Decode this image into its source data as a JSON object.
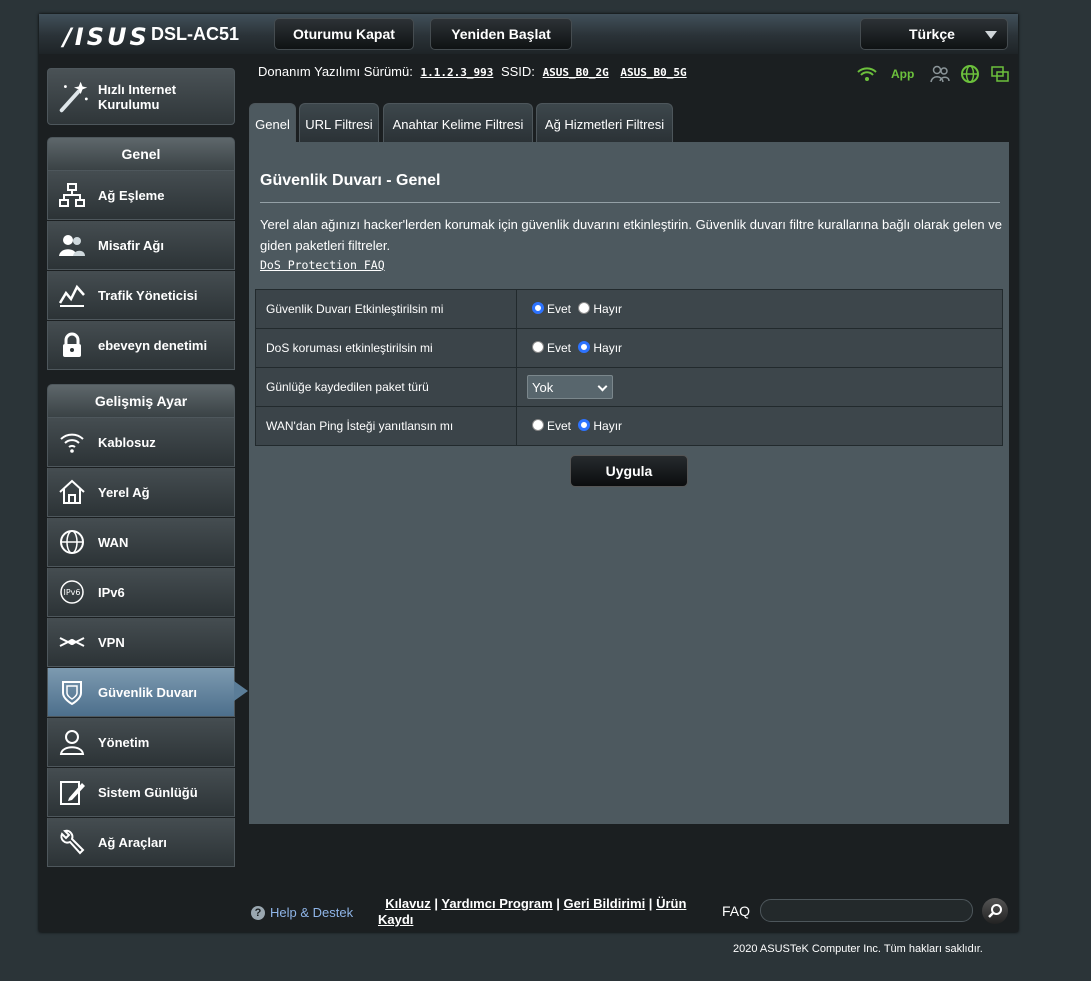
{
  "header": {
    "logo": "/ISUS",
    "model": "DSL-AC51",
    "logout_label": "Oturumu Kapat",
    "reboot_label": "Yeniden Başlat",
    "language": "Türkçe"
  },
  "sidebar": {
    "qis_label": "Hızlı Internet Kurulumu",
    "general_title": "Genel",
    "general_items": [
      {
        "label": "Ağ Eşleme",
        "icon": "network-map-icon"
      },
      {
        "label": "Misafir Ağı",
        "icon": "guest-network-icon"
      },
      {
        "label": "Trafik Yöneticisi",
        "icon": "traffic-manager-icon"
      },
      {
        "label": "ebeveyn denetimi",
        "icon": "lock-icon"
      }
    ],
    "advanced_title": "Gelişmiş Ayar",
    "advanced_items": [
      {
        "label": "Kablosuz",
        "icon": "wifi-icon"
      },
      {
        "label": "Yerel Ağ",
        "icon": "home-icon"
      },
      {
        "label": "WAN",
        "icon": "globe-icon"
      },
      {
        "label": "IPv6",
        "icon": "ipv6-icon"
      },
      {
        "label": "VPN",
        "icon": "vpn-icon"
      },
      {
        "label": "Güvenlik Duvarı",
        "icon": "shield-icon",
        "active": true
      },
      {
        "label": "Yönetim",
        "icon": "admin-user-icon"
      },
      {
        "label": "Sistem Günlüğü",
        "icon": "system-log-icon"
      },
      {
        "label": "Ağ Araçları",
        "icon": "tools-icon"
      }
    ]
  },
  "status": {
    "firmware_label": "Donanım Yazılımı Sürümü:",
    "firmware_version": "1.1.2.3_993",
    "ssid_label": "SSID:",
    "ssid_2g": "ASUS_B0_2G",
    "ssid_5g": "ASUS_B0_5G",
    "app_label": "App",
    "accent_green": "#6cc13c"
  },
  "tabs": [
    "Genel",
    "URL Filtresi",
    "Anahtar Kelime Filtresi",
    "Ağ Hizmetleri Filtresi"
  ],
  "content": {
    "title": "Güvenlik Duvarı - Genel",
    "description": "Yerel alan ağınızı hacker'lerden korumak için güvenlik duvarını etkinleştirin. Güvenlik duvarı filtre kurallarına bağlı olarak gelen ve giden paketleri filtreler.",
    "faq_link": "DoS Protection FAQ",
    "rows": {
      "firewall": {
        "label": "Güvenlik Duvarı Etkinleştirilsin mi",
        "yes": "Evet",
        "no": "Hayır",
        "selected": "yes"
      },
      "dos": {
        "label": "DoS koruması etkinleştirilsin mi",
        "yes": "Evet",
        "no": "Hayır",
        "selected": "no"
      },
      "log": {
        "label": "Günlüğe kaydedilen paket türü",
        "value": "Yok"
      },
      "ping": {
        "label": "WAN'dan Ping İsteği yanıtlansın mı",
        "yes": "Evet",
        "no": "Hayır",
        "selected": "no"
      }
    },
    "apply_label": "Uygula"
  },
  "footer": {
    "help_label": "Help & Destek",
    "link_manual": "Kılavuz",
    "link_utility": "Yardımcı Program",
    "link_feedback": "Geri Bildirimi",
    "link_register": "Ürün Kaydı",
    "faq_label": "FAQ",
    "copyright": "2020 ASUSTeK Computer Inc. Tüm hakları saklıdır."
  }
}
